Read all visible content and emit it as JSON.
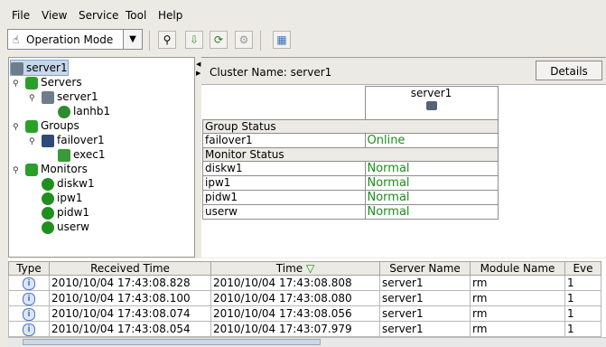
{
  "menu": [
    {
      "key": "file",
      "label": "File"
    },
    {
      "key": "view",
      "label": "View"
    },
    {
      "key": "service",
      "label": "Service"
    },
    {
      "key": "tool",
      "label": "Tool"
    },
    {
      "key": "help",
      "label": "Help"
    }
  ],
  "toolbar": {
    "mode_label": "Operation Mode"
  },
  "tree": {
    "root": "server1",
    "servers": "Servers",
    "server": "server1",
    "lanhb": "lanhb1",
    "groups": "Groups",
    "group": "failover1",
    "exec": "exec1",
    "monitors": "Monitors",
    "m1": "diskw1",
    "m2": "ipw1",
    "m3": "pidw1",
    "m4": "userw"
  },
  "cluster": {
    "name": "Cluster Name: server1",
    "details_label": "Details",
    "server_col": "server1"
  },
  "status": {
    "group_header": "Group Status",
    "group_row": {
      "name": "failover1",
      "value": "Online"
    },
    "monitor_header": "Monitor Status",
    "monitor_rows": [
      {
        "name": "diskw1",
        "value": "Normal"
      },
      {
        "name": "ipw1",
        "value": "Normal"
      },
      {
        "name": "pidw1",
        "value": "Normal"
      },
      {
        "name": "userw",
        "value": "Normal"
      }
    ]
  },
  "alerts": {
    "columns": [
      "Type",
      "Received Time",
      "Time",
      "Server Name",
      "Module Name",
      "Eve"
    ],
    "rows": [
      {
        "received": "2010/10/04 17:43:08.828",
        "time": "2010/10/04 17:43:08.808",
        "server": "server1",
        "module": "rm",
        "event": "1"
      },
      {
        "received": "2010/10/04 17:43:08.100",
        "time": "2010/10/04 17:43:08.080",
        "server": "server1",
        "module": "rm",
        "event": "1"
      },
      {
        "received": "2010/10/04 17:43:08.074",
        "time": "2010/10/04 17:43:08.056",
        "server": "server1",
        "module": "rm",
        "event": "1"
      },
      {
        "received": "2010/10/04 17:43:08.054",
        "time": "2010/10/04 17:43:07.979",
        "server": "server1",
        "module": "rm",
        "event": "1"
      }
    ]
  },
  "colors": {
    "status_ok": "#1b8d1b"
  }
}
